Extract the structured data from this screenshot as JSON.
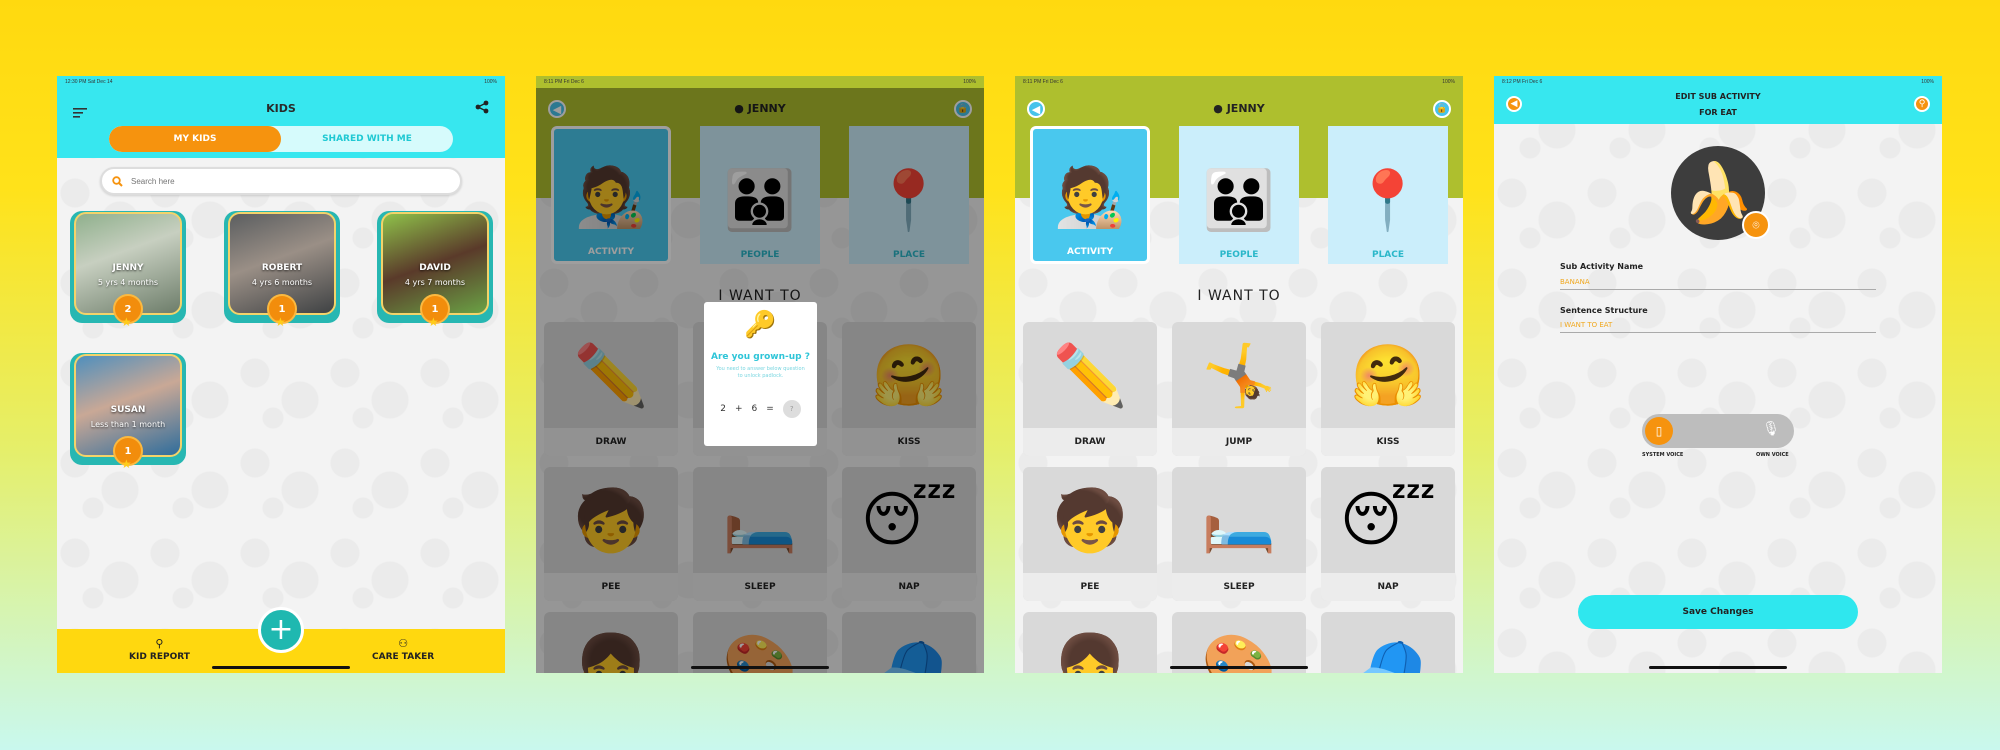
{
  "screen1": {
    "status": {
      "time": "12:30 PM  Sat Dec 14",
      "battery": "100%"
    },
    "title": "KIDS",
    "tabs": [
      {
        "label": "MY KIDS"
      },
      {
        "label": "SHARED WITH ME"
      }
    ],
    "search_placeholder": "Search here",
    "kids": [
      {
        "name": "JENNY",
        "age": "5 yrs 4 months",
        "badge": "2"
      },
      {
        "name": "ROBERT",
        "age": "4 yrs 6 months",
        "badge": "1"
      },
      {
        "name": "DAVID",
        "age": "4 yrs 7 months",
        "badge": "1"
      },
      {
        "name": "SUSAN",
        "age": "Less than 1 month",
        "badge": "1"
      }
    ],
    "bottom_nav": [
      {
        "label": "KID REPORT"
      },
      {
        "label": "CARE TAKER"
      }
    ]
  },
  "screen2": {
    "status": {
      "time": "8:11 PM  Fri Dec 6",
      "battery": "100%"
    },
    "user": "JENNY",
    "categories": [
      {
        "label": "ACTIVITY"
      },
      {
        "label": "PEOPLE"
      },
      {
        "label": "PLACE"
      }
    ],
    "heading": "I WANT TO",
    "activities": [
      {
        "label": "DRAW"
      },
      {
        "label": ""
      },
      {
        "label": "KISS"
      },
      {
        "label": "PEE"
      },
      {
        "label": "SLEEP"
      },
      {
        "label": "NAP"
      }
    ],
    "dialog": {
      "title": "Are you grown-up ?",
      "subtitle": "You need to answer below question to unlock padlock.",
      "a": "2",
      "op": "+",
      "b": "6",
      "eq": "=",
      "answer_placeholder": "?"
    }
  },
  "screen3": {
    "status": {
      "time": "8:11 PM  Fri Dec 6",
      "battery": "100%"
    },
    "user": "JENNY",
    "categories": [
      {
        "label": "ACTIVITY"
      },
      {
        "label": "PEOPLE"
      },
      {
        "label": "PLACE"
      }
    ],
    "heading": "I WANT TO",
    "activities": [
      {
        "label": "DRAW"
      },
      {
        "label": "JUMP"
      },
      {
        "label": "KISS"
      },
      {
        "label": "PEE"
      },
      {
        "label": "SLEEP"
      },
      {
        "label": "NAP"
      }
    ]
  },
  "screen4": {
    "status": {
      "time": "8:12 PM  Fri Dec 6",
      "battery": "100%"
    },
    "title": "EDIT SUB ACTIVITY",
    "subtitle": "FOR EAT",
    "name_label": "Sub Activity Name",
    "name_value": "BANANA",
    "sentence_label": "Sentence Structure",
    "sentence_value": "I WANT TO EAT",
    "voice_left": "SYSTEM VOICE",
    "voice_right": "OWN VOICE",
    "save_label": "Save Changes"
  },
  "colors": {
    "cyan": "#37e7ef",
    "orange": "#f6930e",
    "olive": "#aebf2e",
    "yellow": "#ffd80f",
    "teal": "#1fb8b0"
  },
  "icons": [
    "menu-icon",
    "share-icon",
    "search-icon",
    "plus-icon",
    "back-icon",
    "lock-icon",
    "camera-icon",
    "phone-icon",
    "mic-icon",
    "star-icon"
  ]
}
